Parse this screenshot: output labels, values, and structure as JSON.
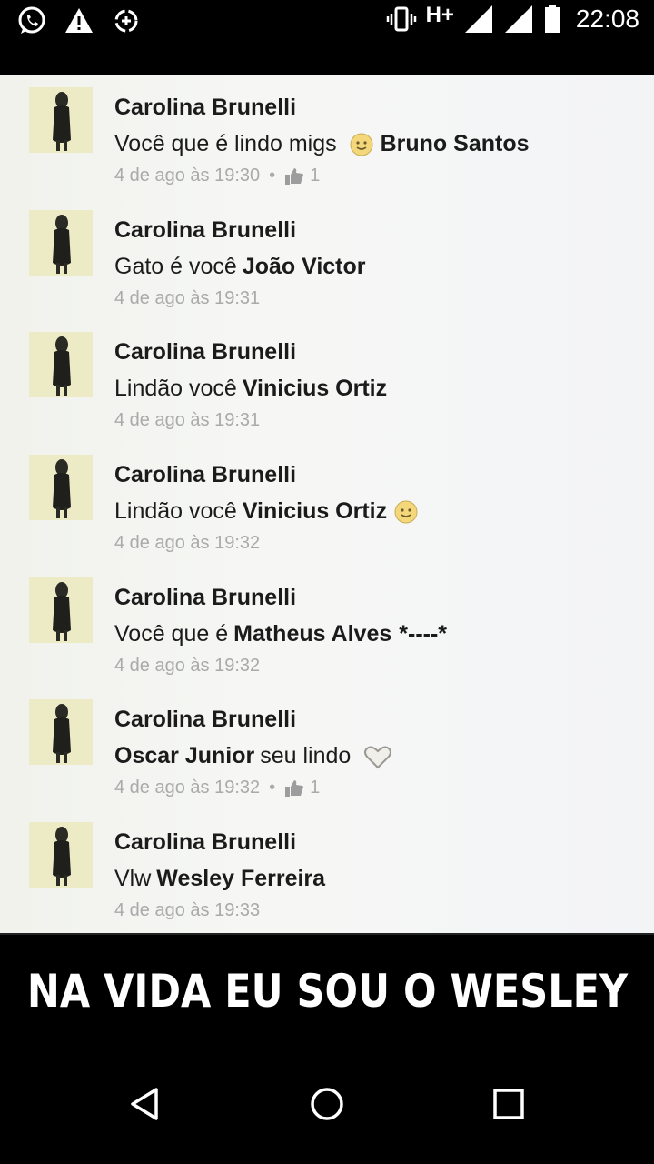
{
  "status_bar": {
    "icons_left": [
      "whatsapp-icon",
      "warning-icon",
      "data-saver-icon"
    ],
    "icons_right": [
      "vibrate-icon",
      "signal-icon",
      "signal-icon",
      "battery-icon"
    ],
    "network_type": "H+",
    "time": "22:08"
  },
  "comments": [
    {
      "author": "Carolina Brunelli",
      "text": "Você que é lindo migs",
      "emoji": "smile",
      "mention": "Bruno Santos",
      "time": "4 de ago às 19:30",
      "likes": "1"
    },
    {
      "author": "Carolina Brunelli",
      "text": "Gato é você",
      "mention": "João Victor",
      "time": "4 de ago às 19:31"
    },
    {
      "author": "Carolina Brunelli",
      "text": "Lindão você",
      "mention": "Vinicius Ortiz",
      "time": "4 de ago às 19:31"
    },
    {
      "author": "Carolina Brunelli",
      "text": "Lindão você",
      "mention": "Vinicius Ortiz",
      "emoji_after": "smile",
      "time": "4 de ago às 19:32"
    },
    {
      "author": "Carolina Brunelli",
      "text": "Você que é",
      "mention": "Matheus Alves",
      "tail": "*----*",
      "time": "4 de ago às 19:32"
    },
    {
      "author": "Carolina Brunelli",
      "mention": "Oscar Junior",
      "text_after": "seu lindo",
      "emoji_after": "heart",
      "time": "4 de ago às 19:32",
      "likes": "1"
    },
    {
      "author": "Carolina Brunelli",
      "text": "Vlw",
      "mention": "Wesley Ferreira",
      "time": "4 de ago às 19:33"
    }
  ],
  "meta_separator": "•",
  "caption": "NA VIDA EU SOU O WESLEY",
  "colors": {
    "feed_bg": "#f3f4f2",
    "meta_text": "#a9aaa9",
    "caption_bg": "#000000",
    "caption_text": "#ffffff"
  }
}
